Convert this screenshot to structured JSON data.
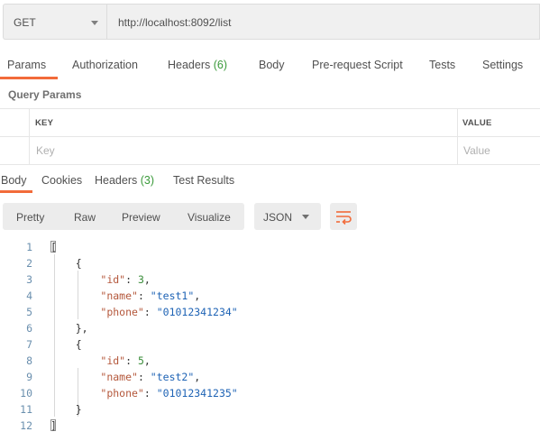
{
  "request": {
    "method": "GET",
    "url": "http://localhost:8092/list"
  },
  "request_tabs": [
    {
      "label": "Params",
      "active": true
    },
    {
      "label": "Authorization"
    },
    {
      "label": "Headers",
      "count": "(6)"
    },
    {
      "label": "Body"
    },
    {
      "label": "Pre-request Script"
    },
    {
      "label": "Tests"
    },
    {
      "label": "Settings"
    }
  ],
  "query_params": {
    "title": "Query Params",
    "columns": [
      "KEY",
      "VALUE"
    ],
    "placeholders": {
      "key": "Key",
      "value": "Value"
    }
  },
  "response_tabs": [
    {
      "label": "Body",
      "active": true
    },
    {
      "label": "Cookies"
    },
    {
      "label": "Headers",
      "count": "(3)"
    },
    {
      "label": "Test Results"
    }
  ],
  "toolbar": {
    "views": [
      "Pretty",
      "Raw",
      "Preview",
      "Visualize"
    ],
    "format": "JSON",
    "wrap_icon": "wrap-lines-icon"
  },
  "colors": {
    "accent": "#f26b3a",
    "count": "#3a9a3a",
    "string": "#1e63b5",
    "number": "#3b8e3b",
    "key": "#a0522d"
  },
  "response_body": {
    "line_numbers": [
      "1",
      "2",
      "3",
      "4",
      "5",
      "6",
      "7",
      "8",
      "9",
      "10",
      "11",
      "12"
    ],
    "records": [
      {
        "id": "3",
        "name": "\"test1\"",
        "phone": "\"01012341234\""
      },
      {
        "id": "5",
        "name": "\"test2\"",
        "phone": "\"01012341235\""
      }
    ],
    "keys": {
      "id": "\"id\"",
      "name": "\"name\"",
      "phone": "\"phone\""
    }
  }
}
